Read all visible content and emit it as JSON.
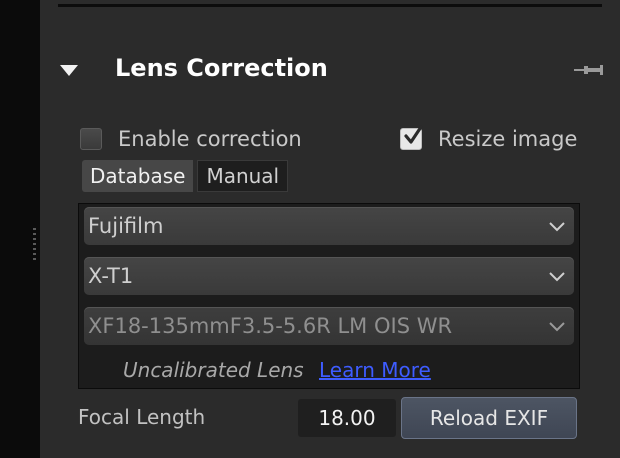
{
  "panel": {
    "title": "Lens Correction",
    "pin_icon": "pin-icon",
    "collapse_icon": "triangle-down-icon"
  },
  "options": {
    "enable_correction": {
      "label": "Enable correction",
      "checked": false
    },
    "resize_image": {
      "label": "Resize image",
      "checked": true
    }
  },
  "tabs": [
    {
      "label": "Database",
      "active": true
    },
    {
      "label": "Manual",
      "active": false
    }
  ],
  "database": {
    "make": "Fujifilm",
    "model": "X-T1",
    "lens": "XF18-135mmF3.5-5.6R LM OIS WR",
    "status_text": "Uncalibrated Lens",
    "learn_more": "Learn More"
  },
  "focal": {
    "label": "Focal Length",
    "value": "18.00",
    "reload_label": "Reload EXIF"
  },
  "colors": {
    "link": "#3e5cff",
    "panel_bg": "#2b2b2b"
  }
}
